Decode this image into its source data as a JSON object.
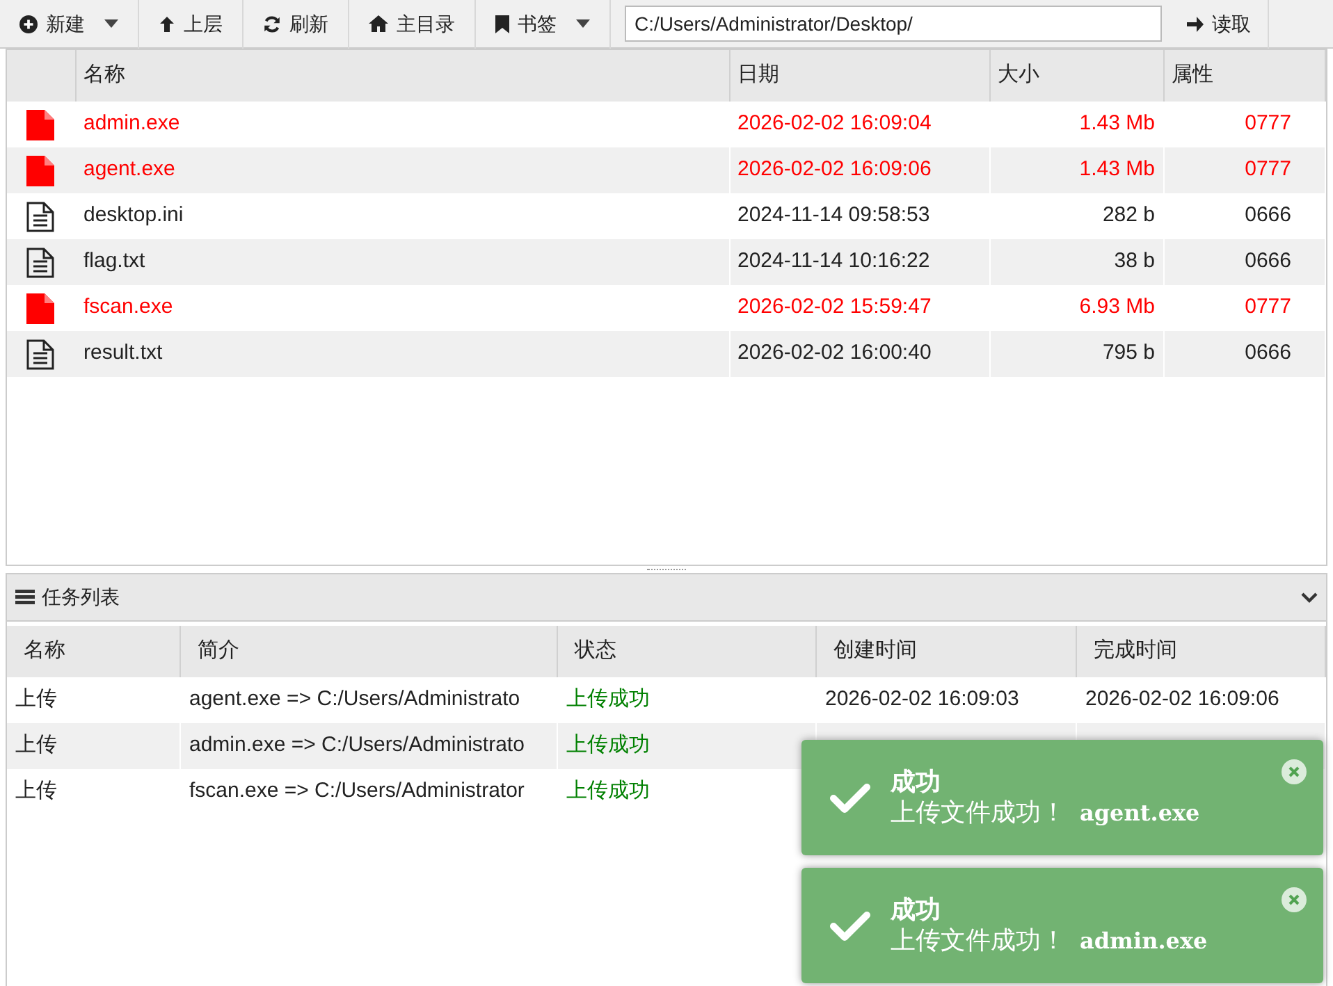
{
  "toolbar": {
    "buttons": [
      {
        "label": "新建",
        "dropdown": true
      },
      {
        "label": "上层",
        "dropdown": false
      },
      {
        "label": "刷新",
        "dropdown": false
      },
      {
        "label": "主目录",
        "dropdown": false
      },
      {
        "label": "书签",
        "dropdown": true
      }
    ],
    "path": "C:/Users/Administrator/Desktop/",
    "read_button": "读取"
  },
  "file_table": {
    "columns": [
      "名称",
      "日期",
      "大小",
      "属性"
    ],
    "rows": [
      {
        "kind": "executable",
        "name": "admin.exe",
        "date": "2026-02-02 16:09:04",
        "size": "1.43 Mb",
        "attr": "0777"
      },
      {
        "kind": "executable",
        "name": "agent.exe",
        "date": "2026-02-02 16:09:06",
        "size": "1.43 Mb",
        "attr": "0777"
      },
      {
        "kind": "text",
        "name": "desktop.ini",
        "date": "2024-11-14 09:58:53",
        "size": "282 b",
        "attr": "0666"
      },
      {
        "kind": "text",
        "name": "flag.txt",
        "date": "2024-11-14 10:16:22",
        "size": "38 b",
        "attr": "0666"
      },
      {
        "kind": "executable",
        "name": "fscan.exe",
        "date": "2026-02-02 15:59:47",
        "size": "6.93 Mb",
        "attr": "0777"
      },
      {
        "kind": "text",
        "name": "result.txt",
        "date": "2026-02-02 16:00:40",
        "size": "795 b",
        "attr": "0666"
      }
    ]
  },
  "task_panel": {
    "title": "任务列表",
    "expanded": true,
    "columns": [
      "名称",
      "简介",
      "状态",
      "创建时间",
      "完成时间"
    ],
    "rows": [
      {
        "name": "上传",
        "summary": "agent.exe => C:/Users/Administrato",
        "status": "上传成功",
        "created": "2026-02-02 16:09:03",
        "finished": "2026-02-02 16:09:06"
      },
      {
        "name": "上传",
        "summary": "admin.exe => C:/Users/Administrato",
        "status": "上传成功"
      },
      {
        "name": "上传",
        "summary": "fscan.exe => C:/Users/Administrator",
        "status": "上传成功"
      }
    ]
  },
  "notifications": [
    {
      "title": "成功",
      "message": "上传文件成功！",
      "file": "agent.exe"
    },
    {
      "title": "成功",
      "message": "上传文件成功！",
      "file": "admin.exe"
    }
  ]
}
